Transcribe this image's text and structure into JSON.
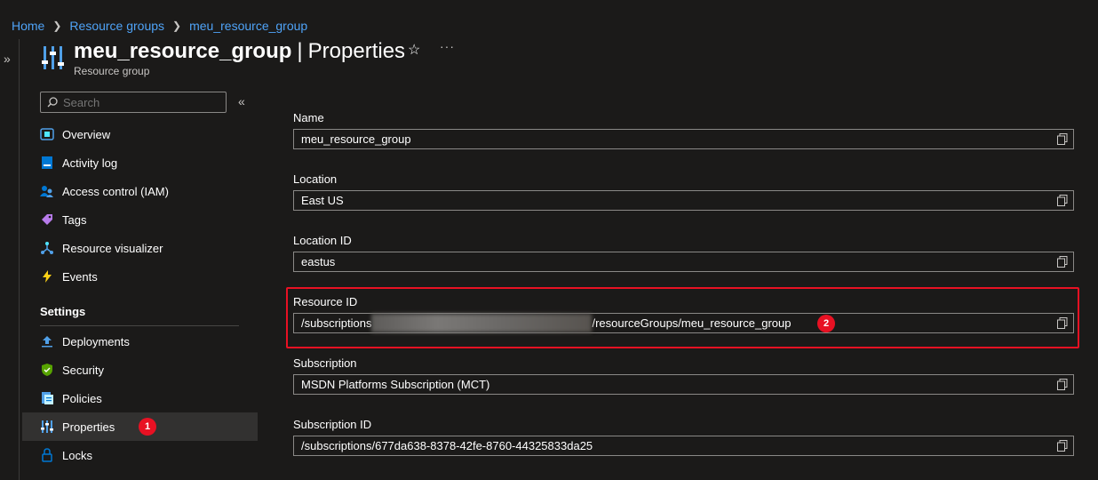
{
  "breadcrumb": {
    "home": "Home",
    "resource_groups": "Resource groups",
    "current": "meu_resource_group"
  },
  "header": {
    "resource_name": "meu_resource_group",
    "separator": "|",
    "page": "Properties",
    "subtitle": "Resource group",
    "star": "☆",
    "more": "···"
  },
  "sidebar": {
    "search_placeholder": "Search",
    "collapse": "«",
    "expand": "»",
    "items": [
      {
        "label": "Overview",
        "icon": "overview-icon"
      },
      {
        "label": "Activity log",
        "icon": "activity-log-icon"
      },
      {
        "label": "Access control (IAM)",
        "icon": "iam-icon"
      },
      {
        "label": "Tags",
        "icon": "tag-icon"
      },
      {
        "label": "Resource visualizer",
        "icon": "visualizer-icon"
      },
      {
        "label": "Events",
        "icon": "lightning-icon"
      }
    ],
    "settings_label": "Settings",
    "settings_items": [
      {
        "label": "Deployments",
        "icon": "upload-icon"
      },
      {
        "label": "Security",
        "icon": "shield-icon"
      },
      {
        "label": "Policies",
        "icon": "policy-icon"
      },
      {
        "label": "Properties",
        "icon": "properties-icon",
        "active": true
      },
      {
        "label": "Locks",
        "icon": "lock-icon"
      }
    ],
    "badge": "1"
  },
  "properties": {
    "name": {
      "label": "Name",
      "value": "meu_resource_group"
    },
    "location": {
      "label": "Location",
      "value": "East US"
    },
    "location_id": {
      "label": "Location ID",
      "value": "eastus"
    },
    "resource_id": {
      "label": "Resource ID",
      "prefix": "/subscriptions",
      "suffix": "/resourceGroups/meu_resource_group",
      "badge": "2"
    },
    "subscription": {
      "label": "Subscription",
      "value": "MSDN Platforms Subscription (MCT)"
    },
    "subscription_id": {
      "label": "Subscription ID",
      "value": "/subscriptions/677da638-8378-42fe-8760-44325833da25"
    }
  },
  "colors": {
    "accent": "#4fa3f7",
    "highlight": "#e81123",
    "background": "#1b1a19"
  }
}
